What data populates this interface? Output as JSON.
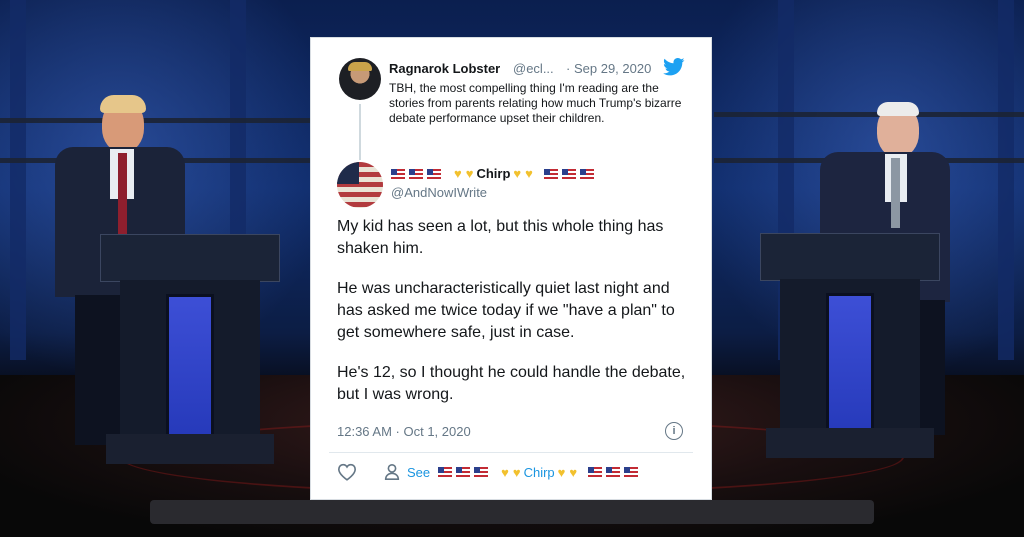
{
  "colors": {
    "twitter_blue": "#1DA1F2",
    "link_blue": "#1b95e0",
    "muted": "#657786",
    "text": "#14171a",
    "card_bg": "#ffffff",
    "stage_blue": "#0f2c6b",
    "heart_yellow": "#f2c12e"
  },
  "icons": [
    "twitter-bird-icon",
    "info-icon",
    "heart-outline-icon",
    "person-icon",
    "flag-icon",
    "yellow-heart-icon"
  ],
  "quoted_tweet": {
    "name": "Ragnarok Lobster",
    "handle": "@ecl...",
    "separator": "·",
    "date": "Sep 29, 2020",
    "text": "TBH, the most compelling thing I'm reading are the stories from parents relating how much Trump's bizarre debate performance upset their children."
  },
  "reply_tweet": {
    "display_name": "Chirp",
    "handle": "@AndNowIWrite",
    "paragraphs": [
      "My kid has seen a lot, but this whole thing has shaken him.",
      "He was uncharacteristically quiet last night and has asked me twice today if we \"have a plan\" to get somewhere safe, just in case.",
      "He's 12, so I thought he could handle the debate, but I was wrong."
    ],
    "timestamp": "12:36 AM · Oct 1, 2020",
    "info_glyph": "i"
  },
  "actions": {
    "see_label": "See",
    "see_name": "Chirp"
  }
}
